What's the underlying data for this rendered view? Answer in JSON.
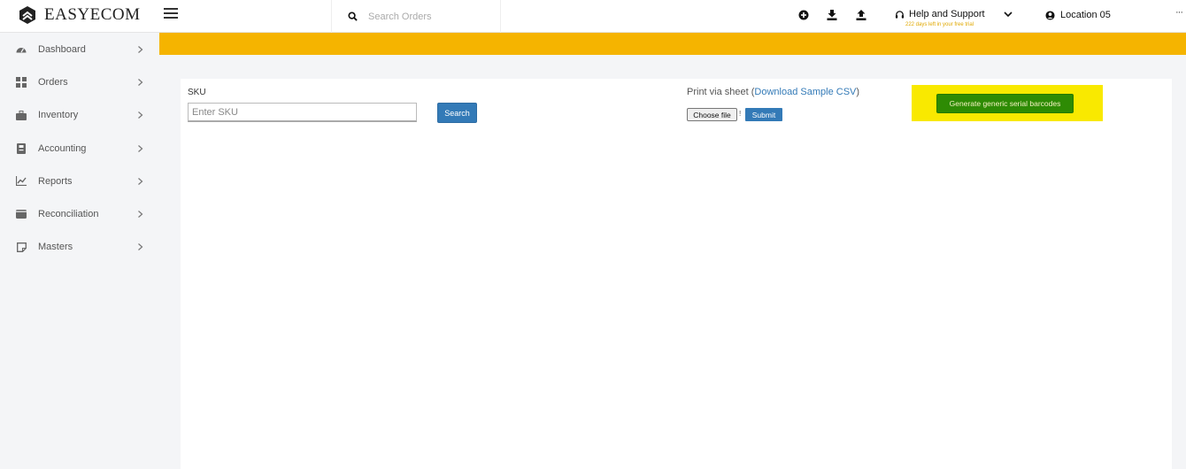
{
  "brand": {
    "name": "EASYECOM"
  },
  "header": {
    "search_placeholder": "Search Orders",
    "help_label": "Help and Support",
    "trial_text": "222 days left in your free trial",
    "location_label": "Location 05",
    "more_label": "···"
  },
  "sidebar": {
    "items": [
      {
        "label": "Dashboard",
        "icon": "dashboard-icon"
      },
      {
        "label": "Orders",
        "icon": "grid-icon"
      },
      {
        "label": "Inventory",
        "icon": "briefcase-icon"
      },
      {
        "label": "Accounting",
        "icon": "ledger-icon"
      },
      {
        "label": "Reports",
        "icon": "chart-line-icon"
      },
      {
        "label": "Reconciliation",
        "icon": "wallet-icon"
      },
      {
        "label": "Masters",
        "icon": "note-icon"
      }
    ]
  },
  "form": {
    "sku_label": "SKU",
    "sku_placeholder": "Enter SKU",
    "search_button": "Search",
    "print_via_sheet": "Print via sheet (",
    "download_link": "Download Sample CSV",
    "print_close": ")",
    "choose_file": "Choose file",
    "file_status": "!",
    "submit_button": "Submit",
    "generate_button": "Generate generic serial barcodes"
  },
  "colors": {
    "banner": "#f5b400",
    "primary": "#337ab7",
    "generate": "#2e8b04",
    "highlight": "#f9e900"
  }
}
